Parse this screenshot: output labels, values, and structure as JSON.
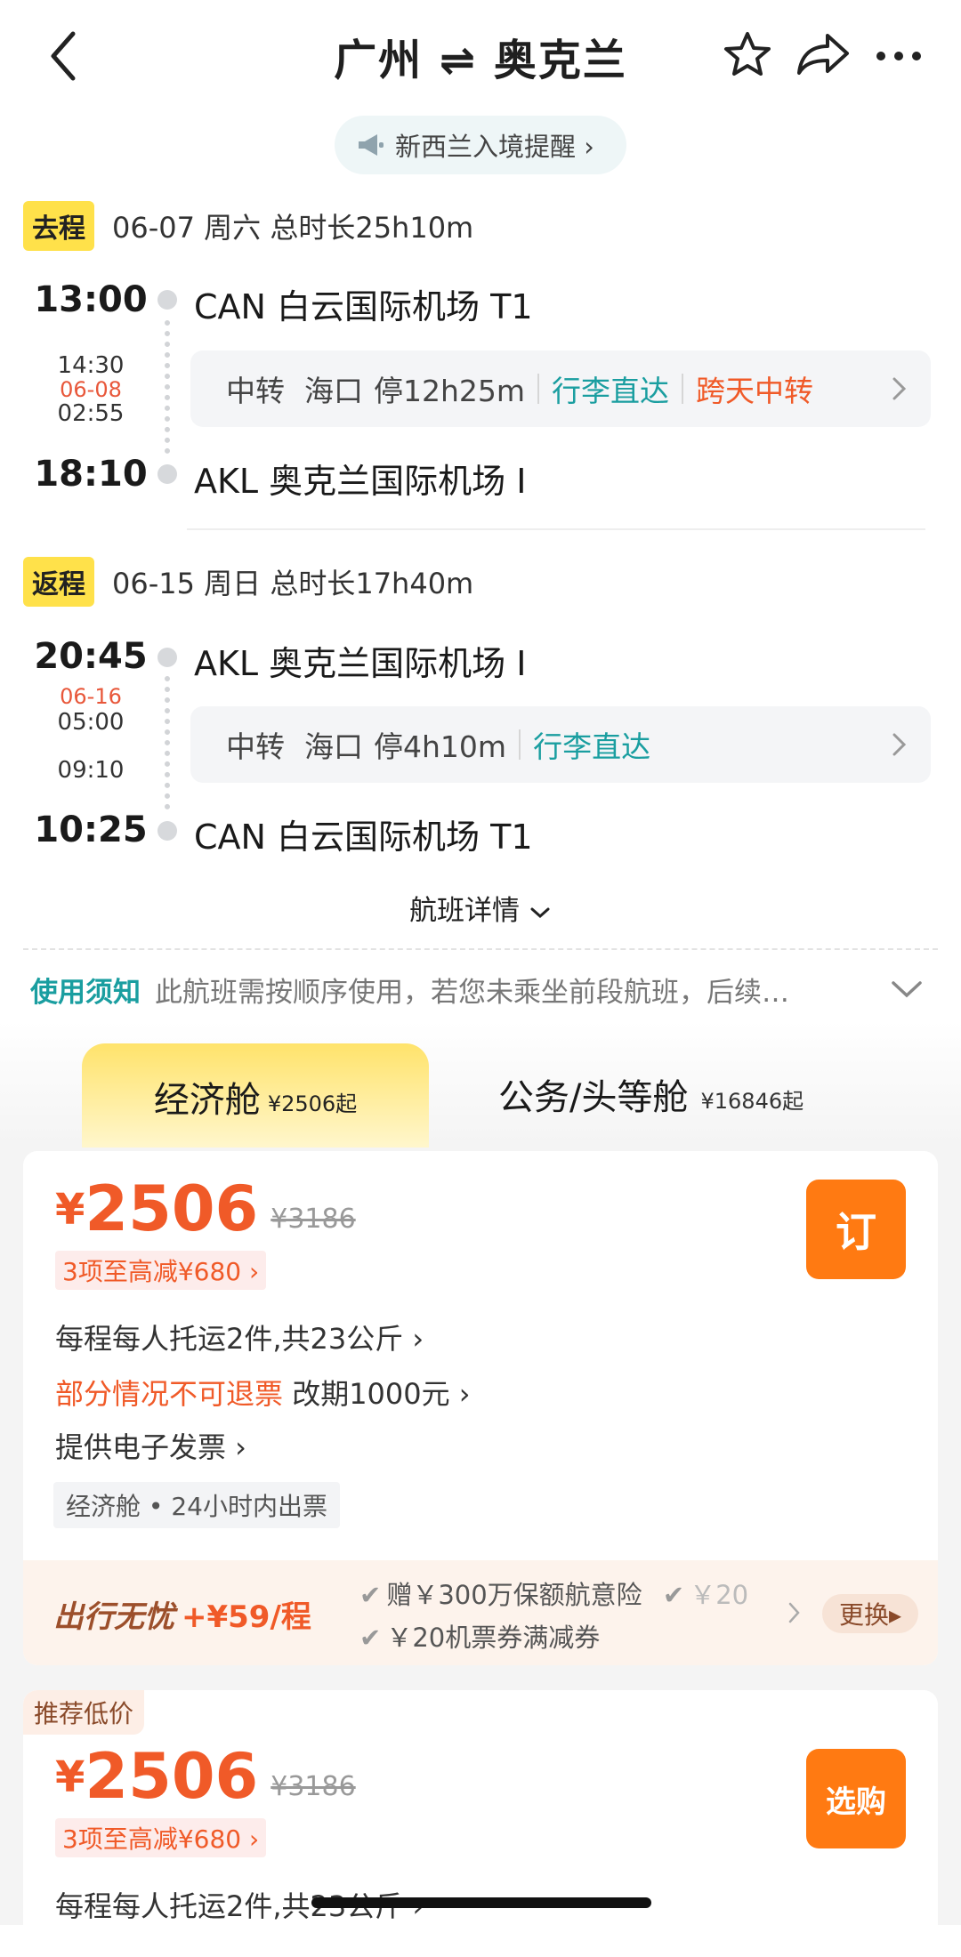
{
  "header": {
    "title": "广州 ⇌ 奥克兰"
  },
  "notice": {
    "label": "新西兰入境提醒 ›"
  },
  "outbound": {
    "tag": "去程",
    "summary": "06-07  周六  总时长25h10m",
    "dep_time": "13:00",
    "dep_airport": "CAN 白云国际机场 T1",
    "arr_time": "18:10",
    "arr_airport": "AKL 奥克兰国际机场 I",
    "stop_arrive": "14:30",
    "stop_date": "06-08",
    "stop_depart": "02:55",
    "transfer": {
      "label": "中转",
      "city": "海口",
      "stay": "停12h25m",
      "baggage": "行李直达",
      "overnight": "跨天中转"
    }
  },
  "return": {
    "tag": "返程",
    "summary": "06-15  周日  总时长17h40m",
    "dep_time": "20:45",
    "dep_airport": "AKL 奥克兰国际机场 I",
    "arr_time": "10:25",
    "arr_airport": "CAN 白云国际机场 T1",
    "stop_date": "06-16",
    "stop_arrive": "05:00",
    "stop_depart": "09:10",
    "transfer": {
      "label": "中转",
      "city": "海口",
      "stay": "停4h10m",
      "baggage": "行李直达"
    }
  },
  "flight_details": "航班详情",
  "rules": {
    "label": "使用须知",
    "text": "此航班需按顺序使用，若您未乘坐前段航班，后续…"
  },
  "tabs": [
    {
      "name": "经济舱",
      "price": "¥2506起"
    },
    {
      "name": "公务/头等舱",
      "price": "¥16846起"
    }
  ],
  "fares": [
    {
      "currency": "¥",
      "price": "2506",
      "orig_price": "¥3186",
      "discount": "3项至高减¥680 ›",
      "book": "订",
      "baggage": "每程每人托运2件,共23公斤 ›",
      "refund_red": "部分情况不可退票",
      "refund_rest": " 改期1000元 ›",
      "invoice": "提供电子发票 ›",
      "cabin_tag": "经济舱 • 24小时内出票",
      "insurance": {
        "title": "出行无忧",
        "price": "+¥59/程",
        "line1": "赠￥300万保额航意险",
        "line1b": "￥20",
        "line2": "￥20机票券满减券",
        "change": "更换▸"
      }
    },
    {
      "rec_tag": "推荐低价",
      "currency": "¥",
      "price": "2506",
      "orig_price": "¥3186",
      "discount": "3项至高减¥680 ›",
      "book": "选购",
      "baggage": "每程每人托运2件,共23公斤 ›"
    }
  ]
}
